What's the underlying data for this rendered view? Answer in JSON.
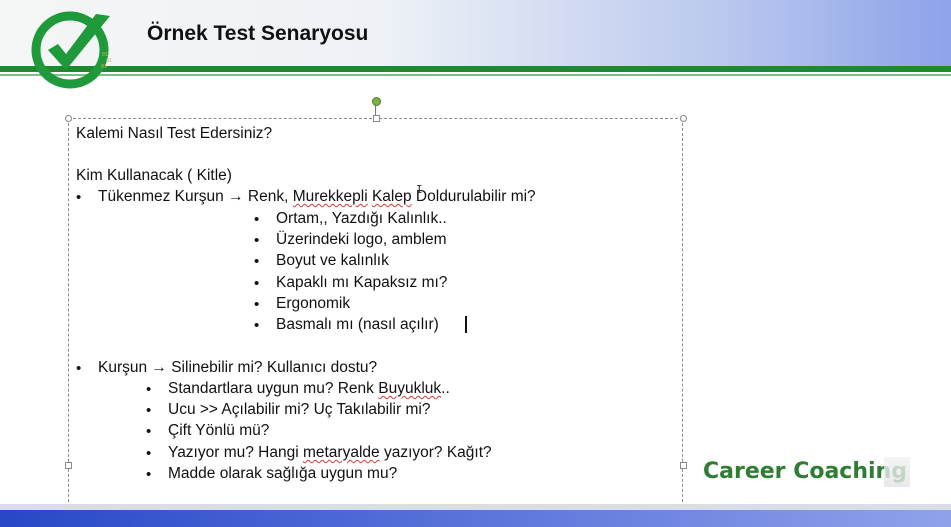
{
  "slide": {
    "title": "Örnek Test Senaryosu",
    "brand": "Career Coaching"
  },
  "content": {
    "question": "Kalemi Nasıl Test Edersiniz?",
    "audience": "Kim Kullanacak  ( Kitle)",
    "item1": {
      "bullet": "•",
      "pre": "Tükenmez Kurşun → Renk, ",
      "word1": "Murekkepli",
      "space": " ",
      "word2": "Kalep",
      "post": " Doldurulabilir mi?",
      "sub": [
        "Ortam,, Yazdığı  Kalınlık..",
        "Üzerindeki logo, amblem",
        "Boyut  ve kalınlık",
        "Kapaklı mı Kapaksız  mı?",
        "Ergonomik",
        "Basmalı mı (nasıl açılır)"
      ]
    },
    "item2": {
      "bullet": "•",
      "text": "Kurşun → Silinebilir mi? Kullanıcı  dostu?",
      "sub1_pre": "  Standartlara  uygun mu? Renk ",
      "sub1_word": "Buyukluk",
      "sub1_post": "..",
      "sub": [
        " Ucu >> Açılabilir mi? Uç Takılabilir mi?",
        "Çift Yönlü mü?"
      ],
      "sub4_pre": "Yazıyor mu? Hangi ",
      "sub4_word": "metaryalde",
      "sub4_post": " yazıyor?  Kağıt?",
      "sub5": "Madde olarak sağlığa uygun mu?"
    }
  },
  "colors": {
    "accent_green": "#1c8a2e",
    "accent_blue": "#2747c7"
  },
  "icons": {
    "logo": "green-checkmark-logo"
  }
}
